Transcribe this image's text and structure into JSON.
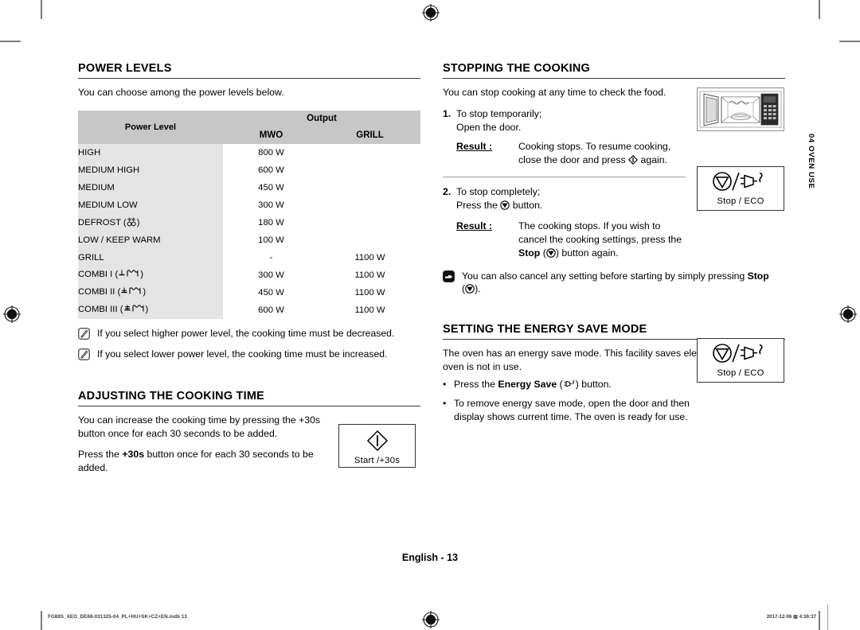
{
  "chapter_tab": "04 OVEN USE",
  "page_number": "English - 13",
  "footer": {
    "left": "FG88S_XEO_DE68-031325-04_PL+HU+SK+CZ+EN.indb   13",
    "right_date": "2017-12-06",
    "right_time": "4:36:37"
  },
  "left_column": {
    "power_levels": {
      "title": "POWER LEVELS",
      "intro": "You can choose among the power levels below.",
      "table": {
        "col_power_level": "Power Level",
        "col_output": "Output",
        "col_mwo": "MWO",
        "col_grill": "GRILL",
        "rows": [
          {
            "name": "HIGH",
            "icon": "",
            "mwo": "800 W",
            "grill": ""
          },
          {
            "name": "MEDIUM HIGH",
            "icon": "",
            "mwo": "600 W",
            "grill": ""
          },
          {
            "name": "MEDIUM",
            "icon": "",
            "mwo": "450 W",
            "grill": ""
          },
          {
            "name": "MEDIUM LOW",
            "icon": "",
            "mwo": "300 W",
            "grill": ""
          },
          {
            "name": "DEFROST",
            "icon": "defrost",
            "mwo": "180 W",
            "grill": ""
          },
          {
            "name": "LOW / KEEP WARM",
            "icon": "",
            "mwo": "100 W",
            "grill": ""
          },
          {
            "name": "GRILL",
            "icon": "",
            "mwo": "-",
            "grill": "1100 W"
          },
          {
            "name": "COMBI I",
            "icon": "combi1",
            "mwo": "300 W",
            "grill": "1100 W"
          },
          {
            "name": "COMBI II",
            "icon": "combi2",
            "mwo": "450 W",
            "grill": "1100 W"
          },
          {
            "name": "COMBI III",
            "icon": "combi3",
            "mwo": "600 W",
            "grill": "1100 W"
          }
        ]
      },
      "note_1": "If you select higher power level, the cooking time must be decreased.",
      "note_2": "If you select lower power level, the cooking time must be increased."
    },
    "adjusting_time": {
      "title": "ADJUSTING THE COOKING TIME",
      "para_1": "You can increase the cooking time by pressing the +30s button once for each 30 seconds to be added.",
      "para_2_a": "Press the ",
      "para_2_b": "+30s",
      "para_2_c": " button once for each 30 seconds to be added.",
      "key_label": "Start /+30s"
    }
  },
  "right_column": {
    "stopping": {
      "title": "STOPPING THE COOKING",
      "intro": "You can stop cooking at any time to check the food.",
      "step_1_num": "1.",
      "step_1_line1": "To stop temporarily;",
      "step_1_line2": "Open the door.",
      "result_label": "Result :",
      "result_1_a": "Cooking stops. To resume cooking,",
      "result_1_b": "close the door and press ",
      "result_1_c": " again.",
      "step_2_num": "2.",
      "step_2_line1": "To stop completely;",
      "step_2_line2_a": "Press the ",
      "step_2_line2_b": " button.",
      "result_2_a": "The cooking stops. If you wish to",
      "result_2_b": "cancel the cooking settings, press the",
      "result_2_c": "Stop",
      "result_2_d": ") button again.",
      "note_a": "You can also cancel any setting before starting by simply pressing ",
      "note_b": "Stop",
      "note_c": ").",
      "key_label": "Stop / ECO"
    },
    "energy_save": {
      "title": "SETTING THE ENERGY SAVE MODE",
      "intro": "The oven has an energy save mode. This facility saves electricity when the oven is not in use.",
      "bullet_1_a": "Press the ",
      "bullet_1_b": "Energy Save",
      "bullet_1_c": ") button.",
      "bullet_2": "To remove energy save mode, open the door and then display shows current time. The oven is ready for use.",
      "key_label": "Stop / ECO"
    }
  },
  "colors": {
    "table_header_bg": "#c7c7c7",
    "table_row_name_bg": "#e4e4e4",
    "rule": "#3b3b3b"
  }
}
